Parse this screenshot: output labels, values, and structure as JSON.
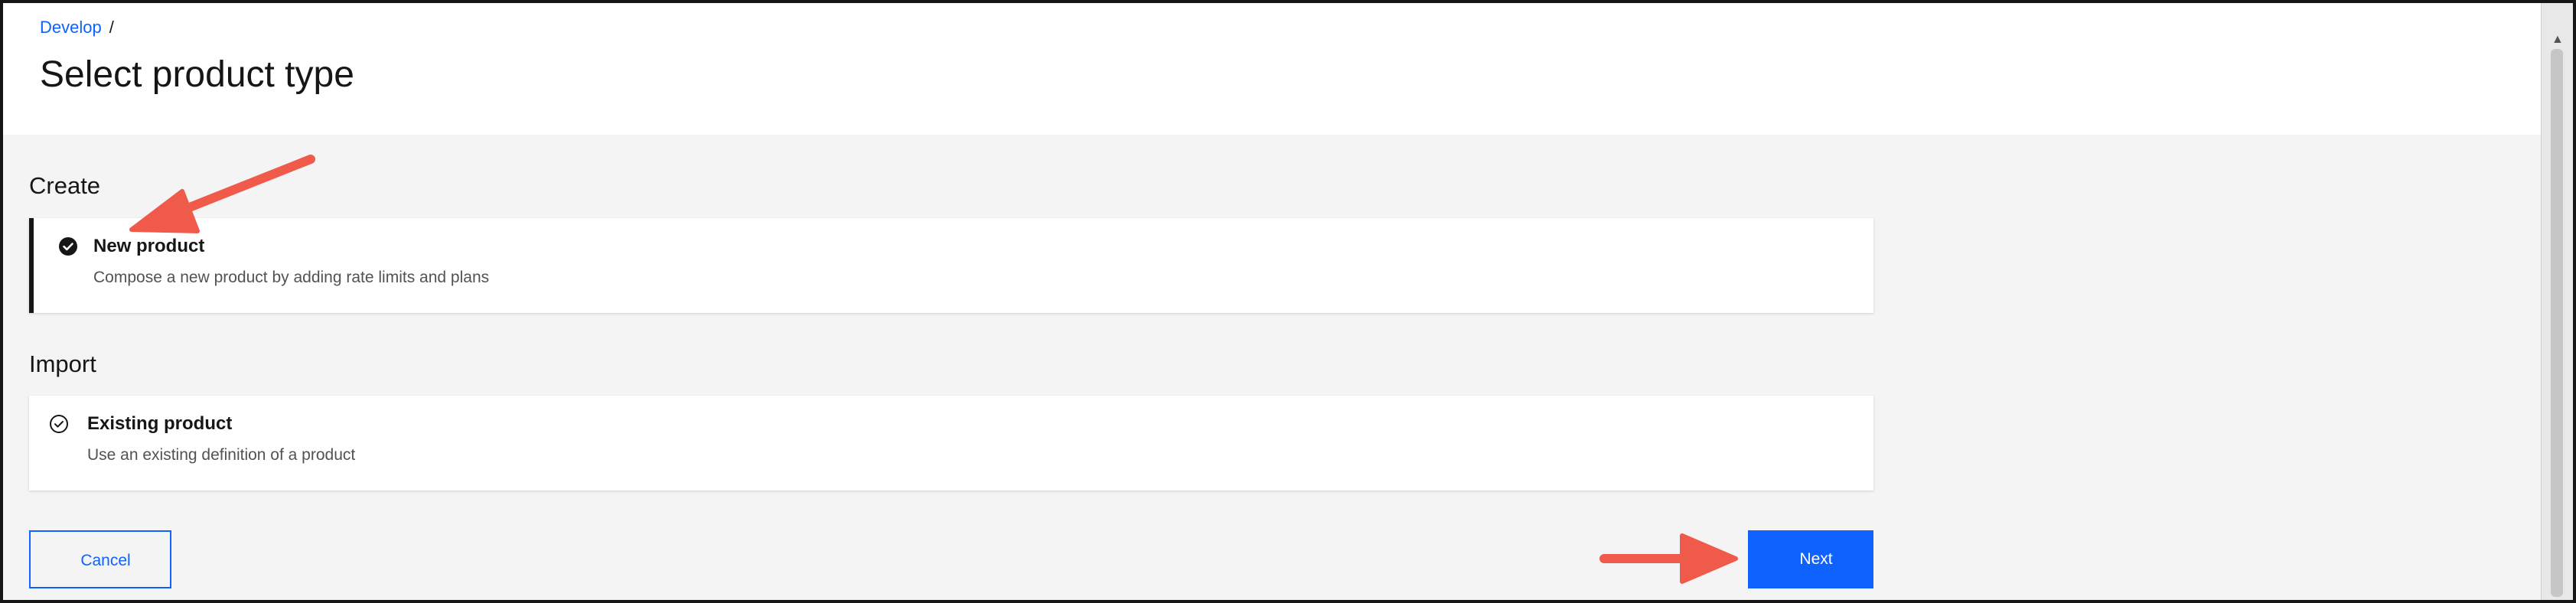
{
  "breadcrumb": {
    "item": "Develop",
    "separator": "/"
  },
  "page": {
    "title": "Select product type"
  },
  "sections": {
    "create": {
      "heading": "Create",
      "tile": {
        "title": "New product",
        "description": "Compose a new product by adding rate limits and plans",
        "selected": true
      }
    },
    "import": {
      "heading": "Import",
      "tile": {
        "title": "Existing product",
        "description": "Use an existing definition of a product",
        "selected": false
      }
    }
  },
  "buttons": {
    "cancel": "Cancel",
    "next": "Next"
  },
  "icons": {
    "selected_tile": "checkmark-filled-icon",
    "unselected_tile": "checkmark-outline-icon",
    "annotation": "arrow-icon"
  },
  "colors": {
    "primary": "#0f62fe",
    "background": "#f4f4f4",
    "annotation": "#f05a4a",
    "text": "#161616"
  }
}
